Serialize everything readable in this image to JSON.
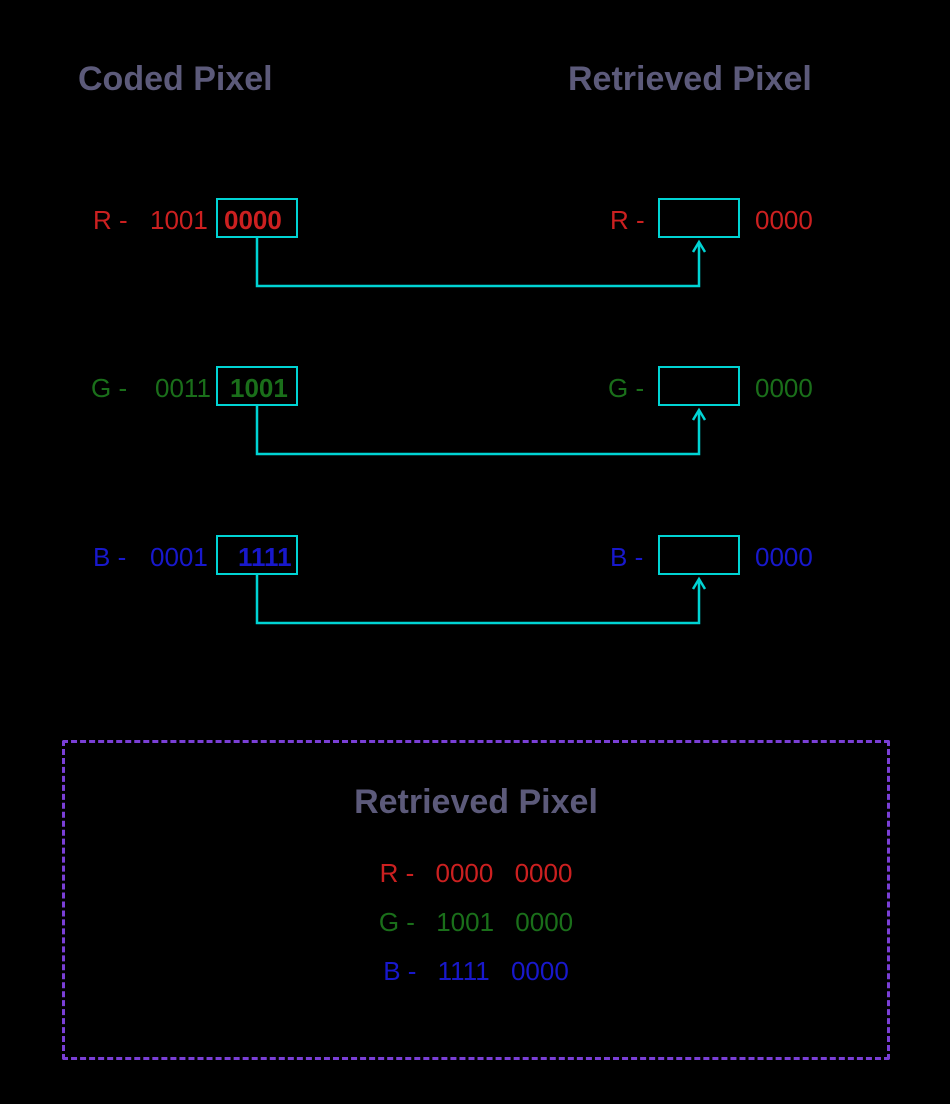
{
  "headers": {
    "left": "Coded Pixel",
    "right": "Retrieved Pixel",
    "result": "Retrieved Pixel"
  },
  "channels": {
    "r": {
      "label": "R -",
      "coded_high": "1001",
      "coded_low": "0000",
      "retrieved_pad": "0000"
    },
    "g": {
      "label": "G -",
      "coded_high": "0011",
      "coded_low": "1001",
      "retrieved_pad": "0000"
    },
    "b": {
      "label": "B -",
      "coded_high": "0001",
      "coded_low": "1111",
      "retrieved_pad": "0000"
    }
  },
  "result": {
    "r": {
      "label": "R -",
      "high": "0000",
      "low": "0000"
    },
    "g": {
      "label": "G -",
      "high": "1001",
      "low": "0000"
    },
    "b": {
      "label": "B -",
      "high": "1111",
      "low": "0000"
    }
  },
  "colors": {
    "cyan": "#00d4d4",
    "purple_dashed": "#7a3fd6",
    "heading": "#5c5a7a",
    "red": "#cc2020",
    "green": "#1a6f1a",
    "blue": "#1818cc"
  }
}
